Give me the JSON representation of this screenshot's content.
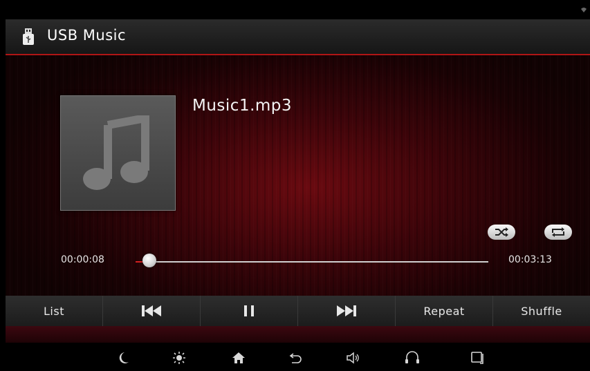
{
  "header": {
    "title": "USB Music"
  },
  "player": {
    "track_name": "Music1.mp3",
    "elapsed": "00:00:08",
    "total": "00:03:13",
    "progress_fraction": 0.04
  },
  "controls": {
    "list_label": "List",
    "repeat_label": "Repeat",
    "shuffle_label": "Shuffle"
  },
  "icons": [
    "usb-icon",
    "music-note-icon",
    "shuffle-icon",
    "repeat-icon",
    "previous-icon",
    "pause-icon",
    "next-icon",
    "night-mode-icon",
    "brightness-icon",
    "home-icon",
    "back-icon",
    "volume-icon",
    "phone-icon",
    "screen-off-icon"
  ],
  "colors": {
    "accent": "#d42020",
    "header_border": "#b01515"
  }
}
